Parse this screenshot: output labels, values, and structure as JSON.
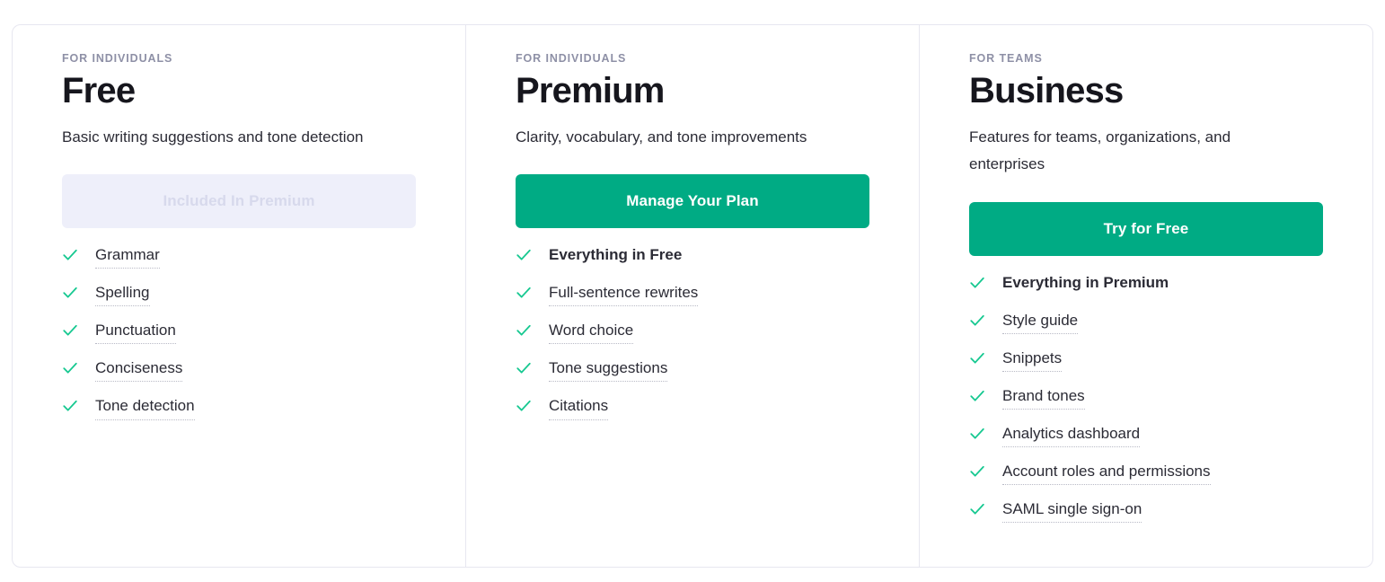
{
  "theme": {
    "accent_green": "#00ab84",
    "check_green": "#15c890",
    "border": "#e7e7f0",
    "disabled_bg": "#eeeffa",
    "disabled_text": "#d7d9ec",
    "eyebrow_text": "#8e90a6",
    "body_text": "#2b2b35",
    "heading_text": "#16161d"
  },
  "plans": [
    {
      "eyebrow": "FOR INDIVIDUALS",
      "name": "Free",
      "description": "Basic writing suggestions and tone detection",
      "cta": {
        "label": "Included In Premium",
        "state": "disabled",
        "interactable": "false"
      },
      "features": [
        {
          "label": "Grammar",
          "highlight": false
        },
        {
          "label": "Spelling",
          "highlight": false
        },
        {
          "label": "Punctuation",
          "highlight": false
        },
        {
          "label": "Conciseness",
          "highlight": false
        },
        {
          "label": "Tone detection",
          "highlight": false
        }
      ]
    },
    {
      "eyebrow": "FOR INDIVIDUALS",
      "name": "Premium",
      "description": "Clarity, vocabulary, and tone improvements",
      "cta": {
        "label": "Manage Your Plan",
        "state": "primary",
        "interactable": "true"
      },
      "features": [
        {
          "label": "Everything in Free",
          "highlight": true
        },
        {
          "label": "Full-sentence rewrites",
          "highlight": false
        },
        {
          "label": "Word choice",
          "highlight": false
        },
        {
          "label": "Tone suggestions",
          "highlight": false
        },
        {
          "label": "Citations",
          "highlight": false
        }
      ]
    },
    {
      "eyebrow": "FOR TEAMS",
      "name": "Business",
      "description": "Features for teams, organizations, and enterprises",
      "cta": {
        "label": "Try for Free",
        "state": "primary",
        "interactable": "true"
      },
      "features": [
        {
          "label": "Everything in Premium",
          "highlight": true
        },
        {
          "label": "Style guide",
          "highlight": false
        },
        {
          "label": "Snippets",
          "highlight": false
        },
        {
          "label": "Brand tones",
          "highlight": false
        },
        {
          "label": "Analytics dashboard",
          "highlight": false
        },
        {
          "label": "Account roles and permissions",
          "highlight": false
        },
        {
          "label": "SAML single sign-on",
          "highlight": false
        }
      ]
    }
  ],
  "icons": {
    "check": "check-icon"
  }
}
